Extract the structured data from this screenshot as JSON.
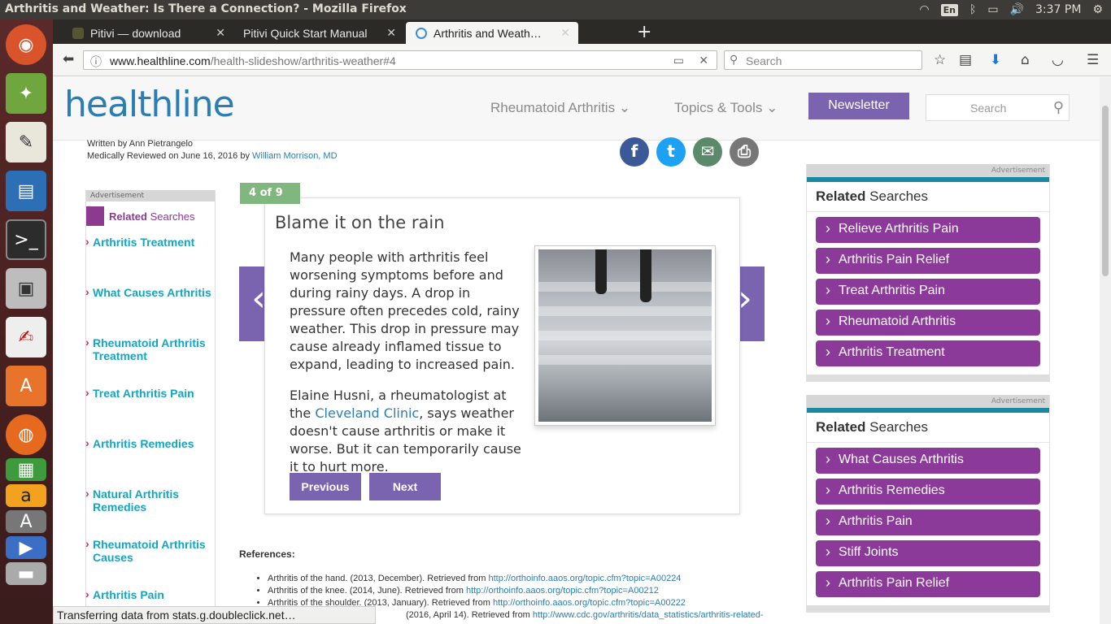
{
  "window": {
    "title": "Arthritis and Weather: Is There a Connection? - Mozilla Firefox",
    "clock": "3:37 PM",
    "keyboard": "En"
  },
  "tabs": [
    {
      "label": "Pitivi — download"
    },
    {
      "label": "Pitivi Quick Start Manual"
    },
    {
      "label": "Arthritis and Weath…"
    }
  ],
  "urlbar": {
    "domain": "www.healthline.com",
    "path": "/health-slideshow/arthritis-weather#4"
  },
  "browser_search": {
    "placeholder": "Search"
  },
  "site": {
    "logo": "healthline",
    "nav": [
      "Rheumatoid Arthritis",
      "Topics & Tools"
    ],
    "newsletter": "Newsletter",
    "search_placeholder": "Search"
  },
  "byline": {
    "written": "Written by Ann Pietrangelo",
    "reviewed_prefix": "Medically Reviewed on June 16, 2016 by",
    "reviewer": "William Morrison, MD"
  },
  "left_related": {
    "ad_label": "Advertisement",
    "heading_bold": "Related",
    "heading_rest": "Searches",
    "items": [
      "Arthritis Treatment",
      "What Causes Arthritis",
      "Rheumatoid Arthritis Treatment",
      "Treat Arthritis Pain",
      "Arthritis Remedies",
      "Natural Arthritis Remedies",
      "Rheumatoid Arthritis Causes",
      "Arthritis Pain"
    ]
  },
  "slide": {
    "counter": "4 of 9",
    "title": "Blame it on the rain",
    "para1": "Many people with arthritis feel worsening symptoms before and during rainy days. A drop in pressure often precedes cold, rainy weather. This drop in pressure may cause already inflamed tissue to expand, leading to increased pain.",
    "para2_pre": "Elaine Husni, a rheumatologist at the",
    "para2_link": "Cleveland Clinic",
    "para2_post": ", says weather doesn't cause arthritis or make it worse. But it can temporarily cause it to hurt more.",
    "prev": "Previous",
    "next": "Next"
  },
  "references": {
    "heading": "References:",
    "items": [
      {
        "text": "Arthritis of the hand. (2013, December). Retrieved from",
        "link": "http://orthoinfo.aaos.org/topic.cfm?topic=A00224"
      },
      {
        "text": "Arthritis of the knee. (2014, June). Retrieved from",
        "link": "http://orthoinfo.aaos.org/topic.cfm?topic=A00212"
      },
      {
        "text": "Arthritis of the shoulder. (2013, January). Retrieved from",
        "link": "http://orthoinfo.aaos.org/topic.cfm?topic=A00222"
      },
      {
        "text": "(2016, April 14). Retrieved from",
        "link": "http://www.cdc.gov/arthritis/data_statistics/arthritis-related-"
      }
    ]
  },
  "right_box1": {
    "ad_label": "Advertisement",
    "heading_bold": "Related",
    "heading_rest": "Searches",
    "items": [
      "Relieve Arthritis Pain",
      "Arthritis Pain Relief",
      "Treat Arthritis Pain",
      "Rheumatoid Arthritis",
      "Arthritis Treatment"
    ]
  },
  "right_box2": {
    "ad_label": "Advertisement",
    "heading_bold": "Related",
    "heading_rest": "Searches",
    "items": [
      "What Causes Arthritis",
      "Arthritis Remedies",
      "Arthritis Pain",
      "Stiff Joints",
      "Arthritis Pain Relief"
    ]
  },
  "status": "Transferring data from stats.g.doubleclick.net…",
  "colors": {
    "accent": "#7a64b0",
    "related": "#8b3a9a",
    "link": "#2a7eb4",
    "teal": "#16a5c0"
  }
}
